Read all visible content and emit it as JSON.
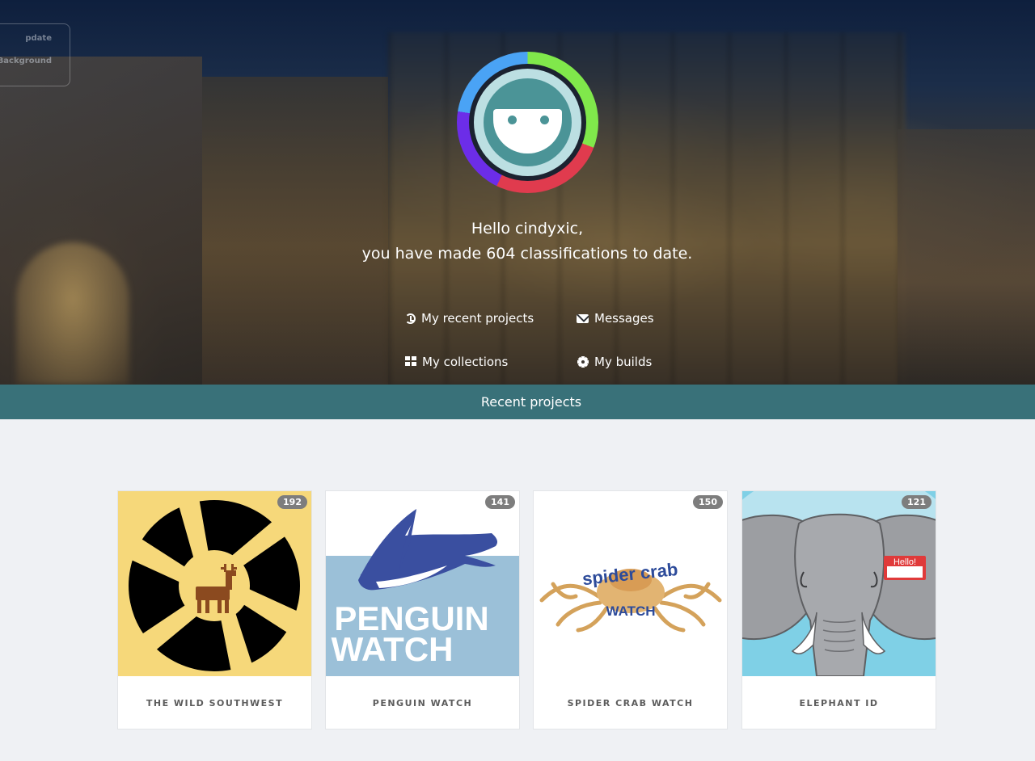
{
  "settings_panel": {
    "line1": "pdate",
    "line2": "Background"
  },
  "hero": {
    "greeting_line1": "Hello cindyxic,",
    "greeting_line2": "you have made 604 classifications to date.",
    "links": {
      "recent_projects": "My recent projects",
      "messages": "Messages",
      "collections": "My collections",
      "builds": "My builds"
    }
  },
  "recent_bar": {
    "label": "Recent projects"
  },
  "projects": [
    {
      "title": "THE WILD SOUTHWEST",
      "count": "192"
    },
    {
      "title": "PENGUIN WATCH",
      "count": "141"
    },
    {
      "title": "SPIDER CRAB WATCH",
      "count": "150"
    },
    {
      "title": "ELEPHANT ID",
      "count": "121"
    }
  ],
  "thumb_text": {
    "penguin_line1": "PENGUIN",
    "penguin_line2": "WATCH",
    "crab_line1": "spider crab",
    "crab_line2": "WATCH",
    "elephant_tag": "Hello!"
  },
  "colors": {
    "accent_bar": "#397179",
    "avatar_ring": [
      "#80e84b",
      "#e03b4e",
      "#6c2de8",
      "#4aa3f5"
    ],
    "badge": "#7d7d7d"
  },
  "icons": {
    "recent_projects": "history-icon",
    "messages": "envelope-icon",
    "collections": "grid-icon",
    "builds": "gear-icon"
  }
}
